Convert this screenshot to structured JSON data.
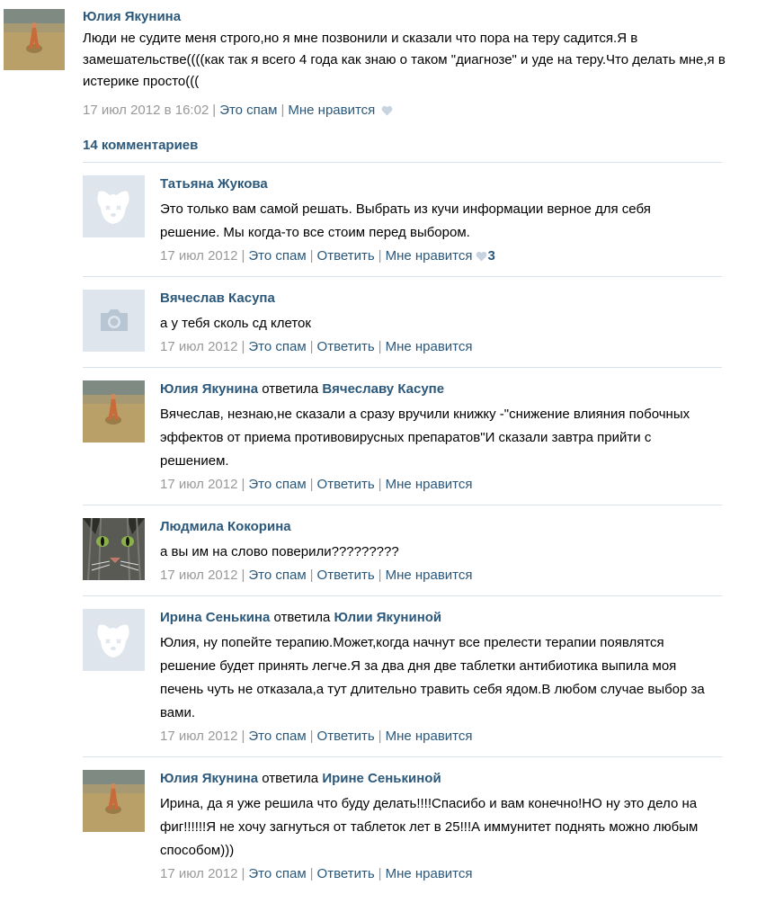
{
  "post": {
    "author": "Юлия Якунина",
    "text": "Люди не судите меня строго,но я мне позвонили и сказали что пора на теру садится.Я в замешательстве((((как так я всего 4 года как знаю о таком \"диагнозе\" и уде на теру.Что делать мне,я в истерике просто(((",
    "date": "17 июл 2012 в 16:02",
    "spam": "Это спам",
    "like": "Мне нравится"
  },
  "comments_header": "14 комментариев",
  "actions": {
    "spam": "Это спам",
    "reply": "Ответить",
    "like": "Мне нравится"
  },
  "comments": [
    {
      "author": "Татьяна Жукова",
      "avatar": "dog-placeholder",
      "text": "Это только вам самой решать. Выбрать из кучи информации верное для себя решение. Мы когда-то все стоим перед выбором.",
      "date": "17 июл 2012",
      "likes": "3"
    },
    {
      "author": "Вячеслав Касупа",
      "avatar": "camera-placeholder",
      "text": "а у тебя сколь сд клеток",
      "date": "17 июл 2012"
    },
    {
      "author": "Юлия Якунина",
      "avatar": "beach-photo",
      "reply_word": "ответила",
      "reply_to": "Вячеславу Касупе",
      "text": "Вячеслав, незнаю,не сказали а сразу вручили книжку -\"снижение влияния побочных эффектов от приема противовирусных препаратов\"И сказали завтра прийти с решением.",
      "date": "17 июл 2012"
    },
    {
      "author": "Людмила Кокорина",
      "avatar": "cat-photo",
      "text": "а вы им на слово поверили?????????",
      "date": "17 июл 2012"
    },
    {
      "author": "Ирина Сенькина",
      "avatar": "dog-placeholder",
      "reply_word": "ответила",
      "reply_to": "Юлии Якуниной",
      "text": "Юлия, ну попейте терапию.Может,когда начнут все прелести терапии появлятся решение будет принять легче.Я за два дня две таблетки антибиотика выпила моя печень чуть не отказала,а тут длительно травить себя ядом.В любом случае выбор за вами.",
      "date": "17 июл 2012"
    },
    {
      "author": "Юлия Якунина",
      "avatar": "beach-photo",
      "reply_word": "ответила",
      "reply_to": "Ирине Сенькиной",
      "text": "Ирина, да я уже решила что буду делать!!!!Спасибо и вам конечно!НО ну это дело на фиг!!!!!!Я не хочу загнуться от таблеток лет в 25!!!А иммунитет поднять можно любым способом)))",
      "date": "17 июл 2012"
    }
  ]
}
